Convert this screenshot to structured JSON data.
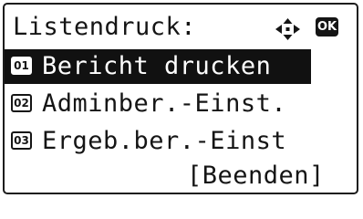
{
  "title": "Listendruck:",
  "header_icons": {
    "navigation": "four-way-arrow-icon",
    "ok": "OK"
  },
  "menu": {
    "items": [
      {
        "number": "01",
        "label": "Bericht drucken",
        "selected": true
      },
      {
        "number": "02",
        "label": "Adminber.-Einst.",
        "selected": false
      },
      {
        "number": "03",
        "label": "Ergeb.ber.-Einst",
        "selected": false
      }
    ]
  },
  "end_button": "[Beenden]",
  "colors": {
    "background": "#ffffff",
    "foreground": "#151515",
    "highlight": "#111111"
  }
}
